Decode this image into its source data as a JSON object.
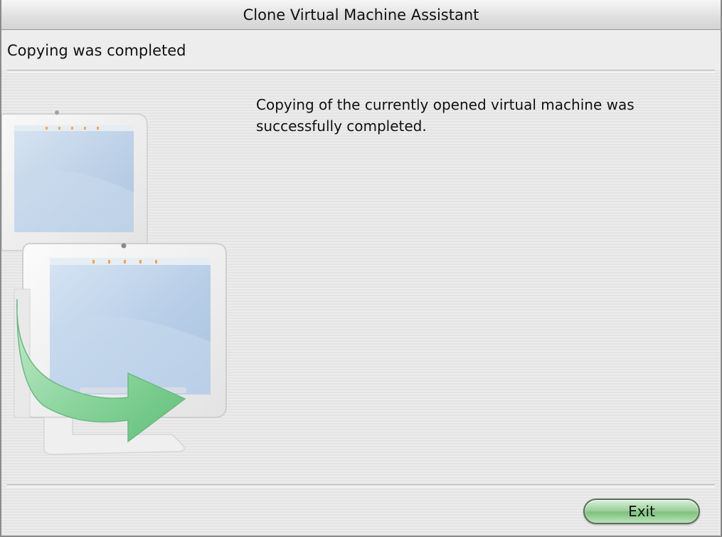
{
  "window": {
    "title": "Clone Virtual Machine Assistant"
  },
  "header": {
    "title": "Copying was completed"
  },
  "main": {
    "message": "Copying of the currently opened virtual machine was successfully completed."
  },
  "footer": {
    "exit_label": "Exit"
  },
  "colors": {
    "button_accent": "#8fcb8f",
    "arrow": "#7ccf8c",
    "screen": "#b9cfe8"
  },
  "icons": {
    "illustration": "computer-clone-illustration"
  }
}
